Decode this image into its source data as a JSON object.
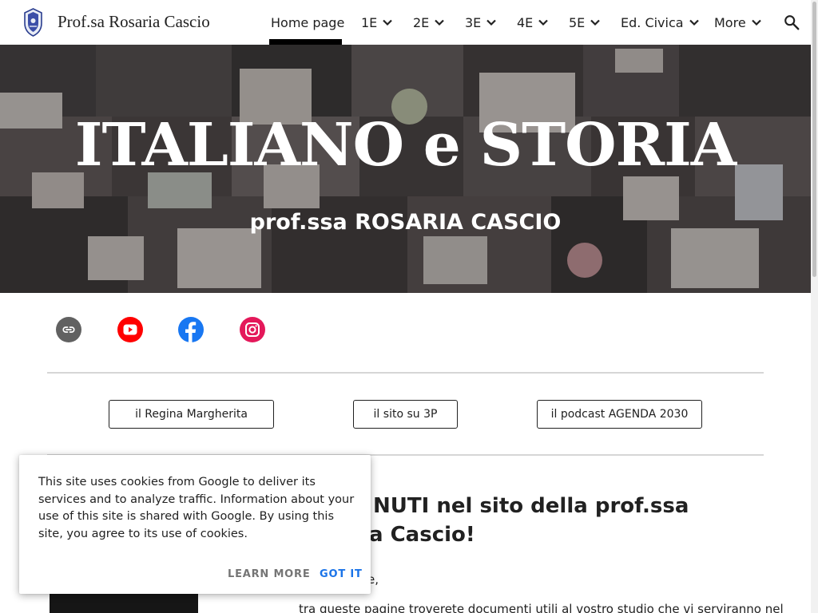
{
  "header": {
    "site_title": "Prof.sa Rosaria Cascio",
    "nav": [
      {
        "label": "Home page",
        "active": true
      },
      {
        "label": "1E",
        "dropdown": true
      },
      {
        "label": "2E",
        "dropdown": true
      },
      {
        "label": "3E",
        "dropdown": true
      },
      {
        "label": "4E",
        "dropdown": true
      },
      {
        "label": "5E",
        "dropdown": true
      },
      {
        "label": "Ed. Civica",
        "dropdown": true
      },
      {
        "label": "More",
        "dropdown": true
      }
    ],
    "search_icon": "search-icon"
  },
  "hero": {
    "title": "ITALIANO e STORIA",
    "subtitle": "prof.ssa ROSARIA CASCIO"
  },
  "social": [
    {
      "icon": "link-icon",
      "color": "#616161"
    },
    {
      "icon": "youtube-icon",
      "color": "#ff0000"
    },
    {
      "icon": "facebook-icon",
      "color": "#1877f2"
    },
    {
      "icon": "instagram-icon",
      "color": "#e4405f"
    }
  ],
  "buttons": [
    {
      "label": "il Regina Margherita"
    },
    {
      "label": "il sito su 3P"
    },
    {
      "label": "il podcast AGENDA 2030"
    }
  ],
  "content": {
    "welcome_line1": "NUTI nel sito della prof.ssa",
    "welcome_line2": "a Cascio!",
    "greeting": "/e,",
    "body_text": "tra queste pagine troverete documenti utili al vostro studio che vi serviranno nel"
  },
  "cookie_banner": {
    "text": "This site uses cookies from Google to deliver its services and to analyze traffic. Information about your use of this site is shared with Google. By using this site, you agree to its use of cookies.",
    "learn_more": "LEARN MORE",
    "got_it": "GOT IT"
  },
  "colors": {
    "accent": "#1a73e8",
    "text": "#212121",
    "divider": "#d6d6d6"
  }
}
